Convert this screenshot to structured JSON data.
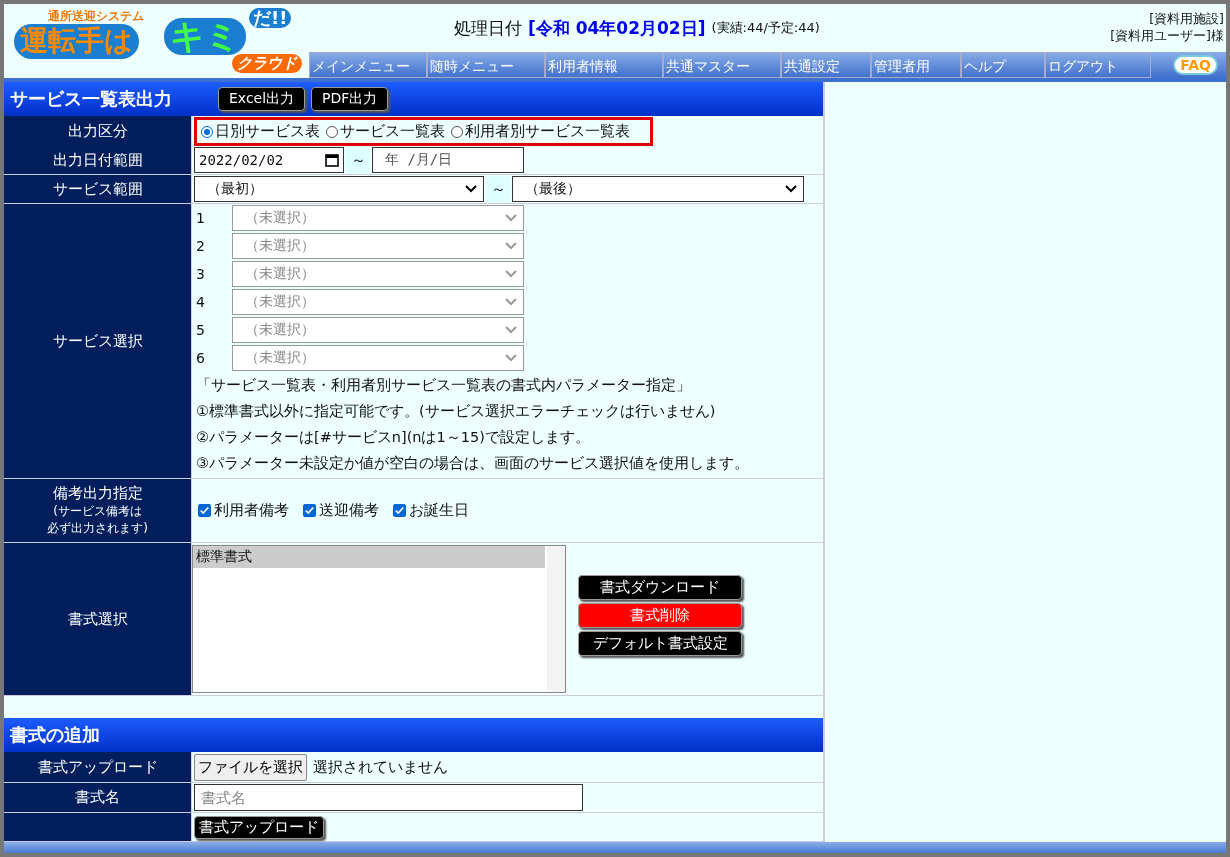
{
  "logo": {
    "tagline": "通所送迎システム",
    "word_1": "運転手は",
    "word_2": "キミ",
    "word_3": "だ!!",
    "word_4": "クラウド"
  },
  "header": {
    "date_label": "処理日付",
    "date": "[令和 04年02月02日]",
    "counts": "(実績:44/予定:44)",
    "facility": "[資料用施設]",
    "user": "[資料用ユーザー]様"
  },
  "nav": {
    "items": [
      "メインメニュー",
      "随時メニュー",
      "利用者情報",
      "共通マスター",
      "共通設定",
      "管理者用",
      "ヘルプ",
      "ログアウト"
    ],
    "faq": "FAQ"
  },
  "section": {
    "title": "サービス一覧表出力",
    "buttons": [
      "Excel出力",
      "PDF出力"
    ]
  },
  "output_type": {
    "label": "出力区分",
    "highlighted": true,
    "options": [
      {
        "label": "日別サービス表",
        "selected": true
      },
      {
        "label": "サービス一覧表",
        "selected": false
      },
      {
        "label": "利用者別サービス一覧表",
        "selected": false
      }
    ]
  },
  "date_range": {
    "label": "出力日付範囲",
    "from": "2022/02/02",
    "separator": "～",
    "to_placeholder": "年 /月/日"
  },
  "service_range": {
    "label": "サービス範囲",
    "from": "（最初）",
    "separator": "～",
    "to": "（最後）"
  },
  "service_select": {
    "label": "サービス選択",
    "slots": [
      {
        "number": "1",
        "value": "（未選択）",
        "disabled": true
      },
      {
        "number": "2",
        "value": "（未選択）",
        "disabled": true
      },
      {
        "number": "3",
        "value": "（未選択）",
        "disabled": true
      },
      {
        "number": "4",
        "value": "（未選択）",
        "disabled": true
      },
      {
        "number": "5",
        "value": "（未選択）",
        "disabled": true
      },
      {
        "number": "6",
        "value": "（未選択）",
        "disabled": true
      }
    ],
    "notes": [
      "「サービス一覧表・利用者別サービス一覧表の書式内パラメーター指定」",
      "①標準書式以外に指定可能です。(サービス選択エラーチェックは行いません)",
      "②パラメーターは[#サービスn](nは1～15)で設定します。",
      "③パラメーター未設定か値が空白の場合は、画面のサービス選択値を使用します。"
    ]
  },
  "remarks": {
    "label": "備考出力指定",
    "note_lines": [
      "(サービス備考は",
      "必ず出力されます)"
    ],
    "checkboxes": [
      {
        "label": "利用者備考",
        "checked": true
      },
      {
        "label": "送迎備考",
        "checked": true
      },
      {
        "label": "お誕生日",
        "checked": true
      }
    ]
  },
  "format_select": {
    "label": "書式選択",
    "items": [
      {
        "label": "標準書式",
        "selected": true
      }
    ],
    "buttons": [
      {
        "label": "書式ダウンロード",
        "kind": "normal"
      },
      {
        "label": "書式削除",
        "kind": "danger"
      },
      {
        "label": "デフォルト書式設定",
        "kind": "normal"
      }
    ]
  },
  "add_section": {
    "title": "書式の追加",
    "upload_label": "書式アップロード",
    "file_button": "ファイルを選択",
    "file_status": "選択されていません",
    "name_label": "書式名",
    "name_placeholder": "書式名",
    "submit": "書式アップロード"
  }
}
